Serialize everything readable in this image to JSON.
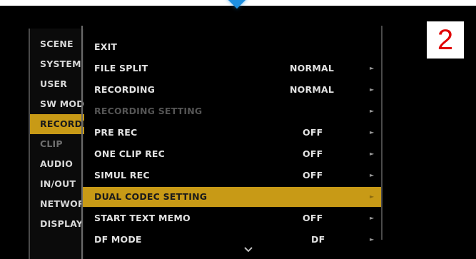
{
  "left_menu": {
    "items": [
      {
        "label": "SCENE",
        "state": "normal"
      },
      {
        "label": "SYSTEM",
        "state": "normal"
      },
      {
        "label": "USER",
        "state": "normal"
      },
      {
        "label": "SW MODE",
        "state": "normal"
      },
      {
        "label": "RECORDING",
        "state": "active"
      },
      {
        "label": "CLIP",
        "state": "dim"
      },
      {
        "label": "AUDIO",
        "state": "normal"
      },
      {
        "label": "IN/OUT",
        "state": "normal"
      },
      {
        "label": "NETWORK",
        "state": "normal"
      },
      {
        "label": "DISPLAY",
        "state": "normal"
      }
    ]
  },
  "sub_menu": {
    "items": [
      {
        "label": "EXIT",
        "value": "",
        "has_arrow": false,
        "state": "normal"
      },
      {
        "label": "FILE SPLIT",
        "value": "NORMAL",
        "has_arrow": true,
        "state": "normal"
      },
      {
        "label": "RECORDING",
        "value": "NORMAL",
        "has_arrow": true,
        "state": "normal"
      },
      {
        "label": "RECORDING SETTING",
        "value": "",
        "has_arrow": true,
        "state": "disabled"
      },
      {
        "label": "PRE REC",
        "value": "OFF",
        "has_arrow": true,
        "state": "normal"
      },
      {
        "label": "ONE CLIP REC",
        "value": "OFF",
        "has_arrow": true,
        "state": "normal"
      },
      {
        "label": "SIMUL REC",
        "value": "OFF",
        "has_arrow": true,
        "state": "normal"
      },
      {
        "label": "DUAL CODEC SETTING",
        "value": "",
        "has_arrow": true,
        "state": "active"
      },
      {
        "label": "START TEXT MEMO",
        "value": "OFF",
        "has_arrow": true,
        "state": "normal"
      },
      {
        "label": "DF MODE",
        "value": "DF",
        "has_arrow": true,
        "state": "normal"
      }
    ],
    "arrow_glyph": "►",
    "scroll_icon": "chevron-down-icon"
  },
  "step_badge": {
    "number": "2",
    "color": "#e00000"
  },
  "colors": {
    "highlight": "#c89a16",
    "background": "#000000",
    "text": "#e2e2e2",
    "disabled_text": "#555555",
    "marker": "#1e8fe0"
  }
}
